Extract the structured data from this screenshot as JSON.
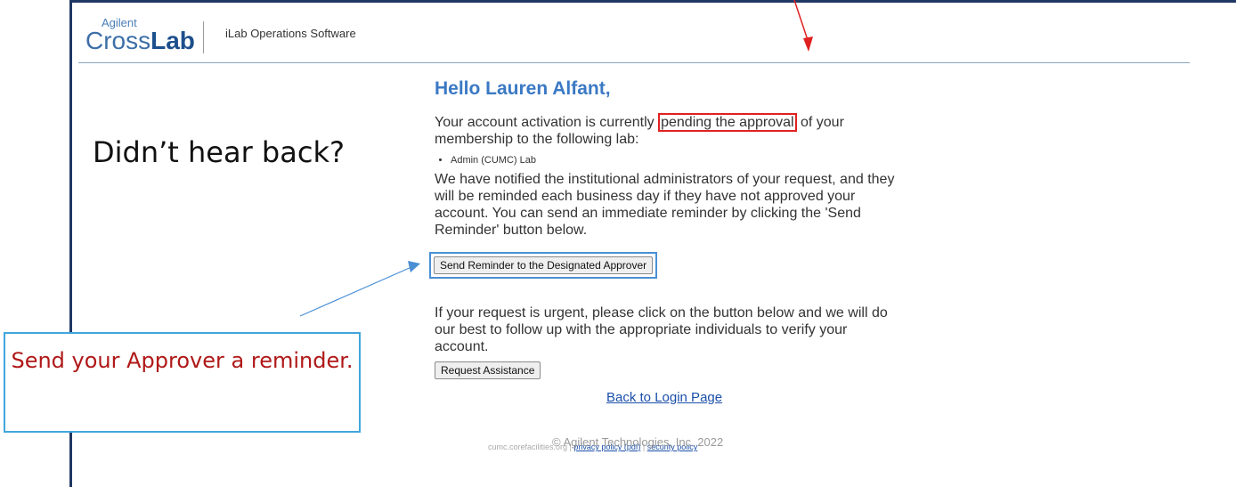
{
  "header": {
    "logo_small": "Agilent",
    "logo_cross": "Cross",
    "logo_lab": "Lab",
    "app_name": "iLab Operations Software"
  },
  "annotations": {
    "side_heading": "Didn’t hear back?",
    "callout_text": "Send your Approver a reminder."
  },
  "main": {
    "greeting": "Hello Lauren Alfant,",
    "para1_before": "Your account activation is currently ",
    "para1_highlight": "pending the approval",
    "para1_after": " of your membership to the following lab:",
    "labs": [
      "Admin (CUMC) Lab"
    ],
    "para2": "We have notified the institutional administrators of your request, and they will be reminded each business day if they have not approved your account. You can send an immediate reminder by clicking the 'Send Reminder' button below.",
    "send_reminder_label": "Send Reminder to the Designated Approver",
    "para3": "If your request is urgent, please click on the button below and we will do our best to follow up with the appropriate individuals to verify your account.",
    "request_assistance_label": "Request Assistance",
    "back_link": "Back to Login Page"
  },
  "footer": {
    "copyright": "© Agilent Technologies, Inc. 2022",
    "domain": "cumc.corefacilities.org | ",
    "privacy": "privacy policy (pdf)",
    "sep": " | ",
    "security": "security policy"
  },
  "colors": {
    "accent_blue": "#3b79c4",
    "highlight_red": "#e02020",
    "callout_border": "#41a6dc",
    "callout_text": "#b01818"
  }
}
